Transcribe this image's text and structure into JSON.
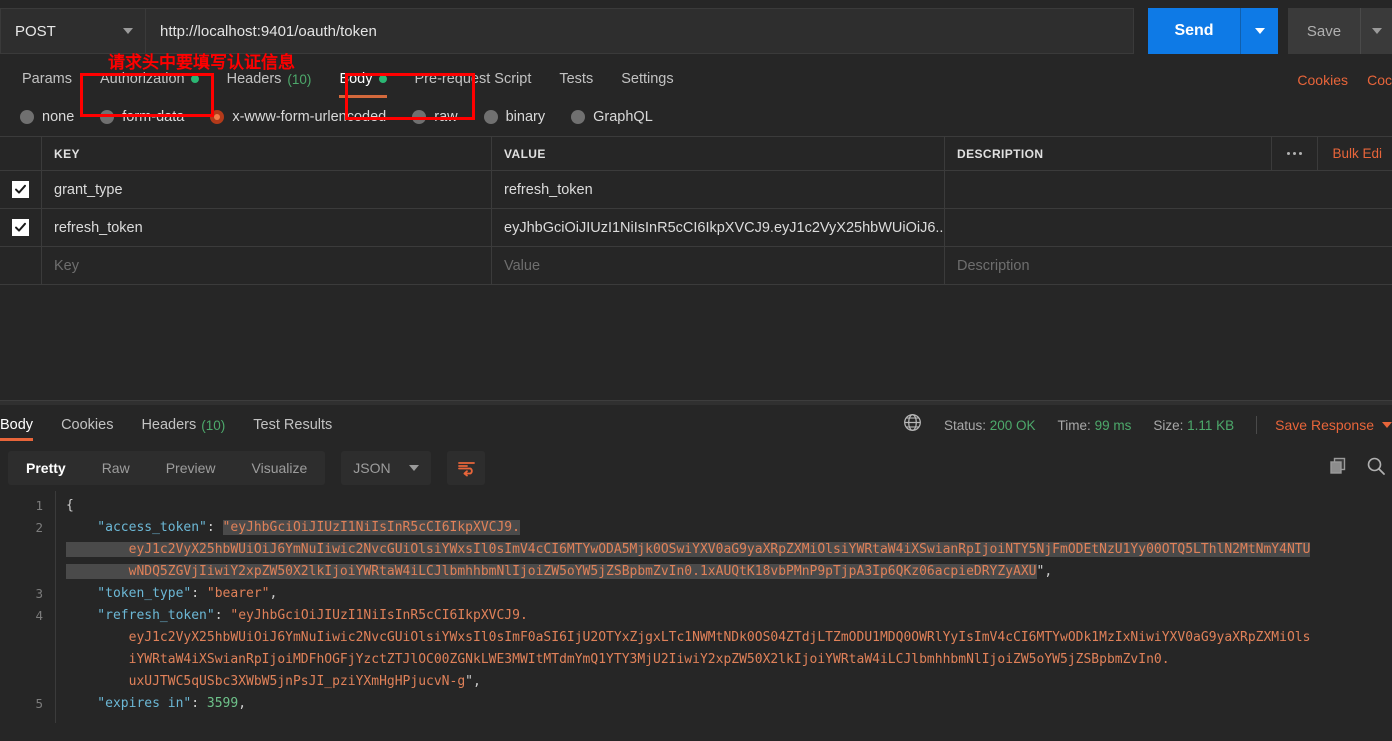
{
  "request": {
    "method": "POST",
    "url": "http://localhost:9401/oauth/token",
    "send_label": "Send",
    "save_label": "Save"
  },
  "annotation": {
    "text": "请求头中要填写认证信息",
    "color": "#ff0000"
  },
  "request_tabs": [
    {
      "label": "Params",
      "badge": "",
      "dot": false,
      "active": false
    },
    {
      "label": "Authorization",
      "badge": "",
      "dot": true,
      "active": false
    },
    {
      "label": "Headers",
      "badge": "(10)",
      "dot": false,
      "active": false
    },
    {
      "label": "Body",
      "badge": "",
      "dot": true,
      "active": true
    },
    {
      "label": "Pre-request Script",
      "badge": "",
      "dot": false,
      "active": false
    },
    {
      "label": "Tests",
      "badge": "",
      "dot": false,
      "active": false
    },
    {
      "label": "Settings",
      "badge": "",
      "dot": false,
      "active": false
    }
  ],
  "request_links": {
    "cookies": "Cookies",
    "code": "Coc"
  },
  "body_types": [
    {
      "label": "none",
      "checked": false
    },
    {
      "label": "form-data",
      "checked": false
    },
    {
      "label": "x-www-form-urlencoded",
      "checked": true
    },
    {
      "label": "raw",
      "checked": false
    },
    {
      "label": "binary",
      "checked": false
    },
    {
      "label": "GraphQL",
      "checked": false
    }
  ],
  "kv_table": {
    "headers": {
      "key": "KEY",
      "value": "VALUE",
      "description": "DESCRIPTION"
    },
    "bulk_edit": "Bulk Edi",
    "rows": [
      {
        "checked": true,
        "key": "grant_type",
        "value": "refresh_token",
        "description": ""
      },
      {
        "checked": true,
        "key": "refresh_token",
        "value": "eyJhbGciOiJIUzI1NiIsInR5cCI6IkpXVCJ9.eyJ1c2VyX25hbWUiOiJ6...",
        "description": ""
      }
    ],
    "placeholder_row": {
      "key": "Key",
      "value": "Value",
      "description": "Description"
    }
  },
  "response_tabs": [
    {
      "label": "Body",
      "badge": "",
      "active": true
    },
    {
      "label": "Cookies",
      "badge": "",
      "active": false
    },
    {
      "label": "Headers",
      "badge": "(10)",
      "active": false
    },
    {
      "label": "Test Results",
      "badge": "",
      "active": false
    }
  ],
  "response_meta": {
    "status_label": "Status:",
    "status_value": "200 OK",
    "time_label": "Time:",
    "time_value": "99 ms",
    "size_label": "Size:",
    "size_value": "1.11 KB",
    "save_response": "Save Response"
  },
  "view_toolbar": {
    "segments": [
      {
        "label": "Pretty",
        "active": true
      },
      {
        "label": "Raw",
        "active": false
      },
      {
        "label": "Preview",
        "active": false
      },
      {
        "label": "Visualize",
        "active": false
      }
    ],
    "format": "JSON"
  },
  "response_body": {
    "line_numbers": [
      "1",
      "2",
      "3",
      "4",
      "5"
    ],
    "lines": [
      {
        "num": "1",
        "segments": [
          {
            "t": "{",
            "c": "punc"
          }
        ]
      },
      {
        "num": "2",
        "segments": [
          {
            "t": "    \"access_token\"",
            "c": "key"
          },
          {
            "t": ": ",
            "c": "punc"
          },
          {
            "t": "\"eyJhbGciOiJIUzI1NiIsInR5cCI6IkpXVCJ9.",
            "c": "str-sel"
          }
        ]
      },
      {
        "num": "",
        "segments": [
          {
            "t": "        eyJ1c2VyX25hbWUiOiJ6YmNuIiwic2NvcGUiOlsiYWxsIl0sImV4cCI6MTYwODA5Mjk0OSwiYXV0aG9yaXRpZXMiOlsiYWRtaW4iXSwianRpIjoiNTY5NjFmODEtNzU1Yy00OTQ5LThlN2MtNmY4NTU",
            "c": "str-sel"
          }
        ]
      },
      {
        "num": "",
        "segments": [
          {
            "t": "        wNDQ5ZGVjIiwiY2xpZW50X2lkIjoiYWRtaW4iLCJlbmhhbmNlIjoiZW5oYW5jZSBpbmZvIn0.1xAUQtK18vbPMnP9pTjpA3Ip6QKz06acpieDRYZyAXU",
            "c": "str-sel"
          },
          {
            "t": "\",",
            "c": "punc"
          }
        ]
      },
      {
        "num": "3",
        "segments": [
          {
            "t": "    \"token_type\"",
            "c": "key"
          },
          {
            "t": ": ",
            "c": "punc"
          },
          {
            "t": "\"bearer\"",
            "c": "str"
          },
          {
            "t": ",",
            "c": "punc"
          }
        ]
      },
      {
        "num": "4",
        "segments": [
          {
            "t": "    \"refresh_token\"",
            "c": "key"
          },
          {
            "t": ": ",
            "c": "punc"
          },
          {
            "t": "\"eyJhbGciOiJIUzI1NiIsInR5cCI6IkpXVCJ9.",
            "c": "str"
          }
        ]
      },
      {
        "num": "",
        "segments": [
          {
            "t": "        eyJ1c2VyX25hbWUiOiJ6YmNuIiwic2NvcGUiOlsiYWxsIl0sImF0aSI6IjU2OTYxZjgxLTc1NWMtNDk0OS04ZTdjLTZmODU1MDQ0OWRlYyIsImV4cCI6MTYwODk1MzIxNiwiYXV0aG9yaXRpZXMiOls",
            "c": "str"
          }
        ]
      },
      {
        "num": "",
        "segments": [
          {
            "t": "        iYWRtaW4iXSwianRpIjoiMDFhOGFjYzctZTJlOC00ZGNkLWE3MWItMTdmYmQ1YTY3MjU2IiwiY2xpZW50X2lkIjoiYWRtaW4iLCJlbmhhbmNlIjoiZW5oYW5jZSBpbmZvIn0.",
            "c": "str"
          }
        ]
      },
      {
        "num": "",
        "segments": [
          {
            "t": "        uxUJTWC5qUSbc3XWbW5jnPsJI_pziYXmHgHPjucvN-g",
            "c": "str"
          },
          {
            "t": "\",",
            "c": "punc"
          }
        ]
      },
      {
        "num": "5",
        "segments": [
          {
            "t": "    \"expires in\"",
            "c": "key"
          },
          {
            "t": ": ",
            "c": "punc"
          },
          {
            "t": "3599",
            "c": "num"
          },
          {
            "t": ",",
            "c": "punc"
          }
        ]
      }
    ]
  }
}
